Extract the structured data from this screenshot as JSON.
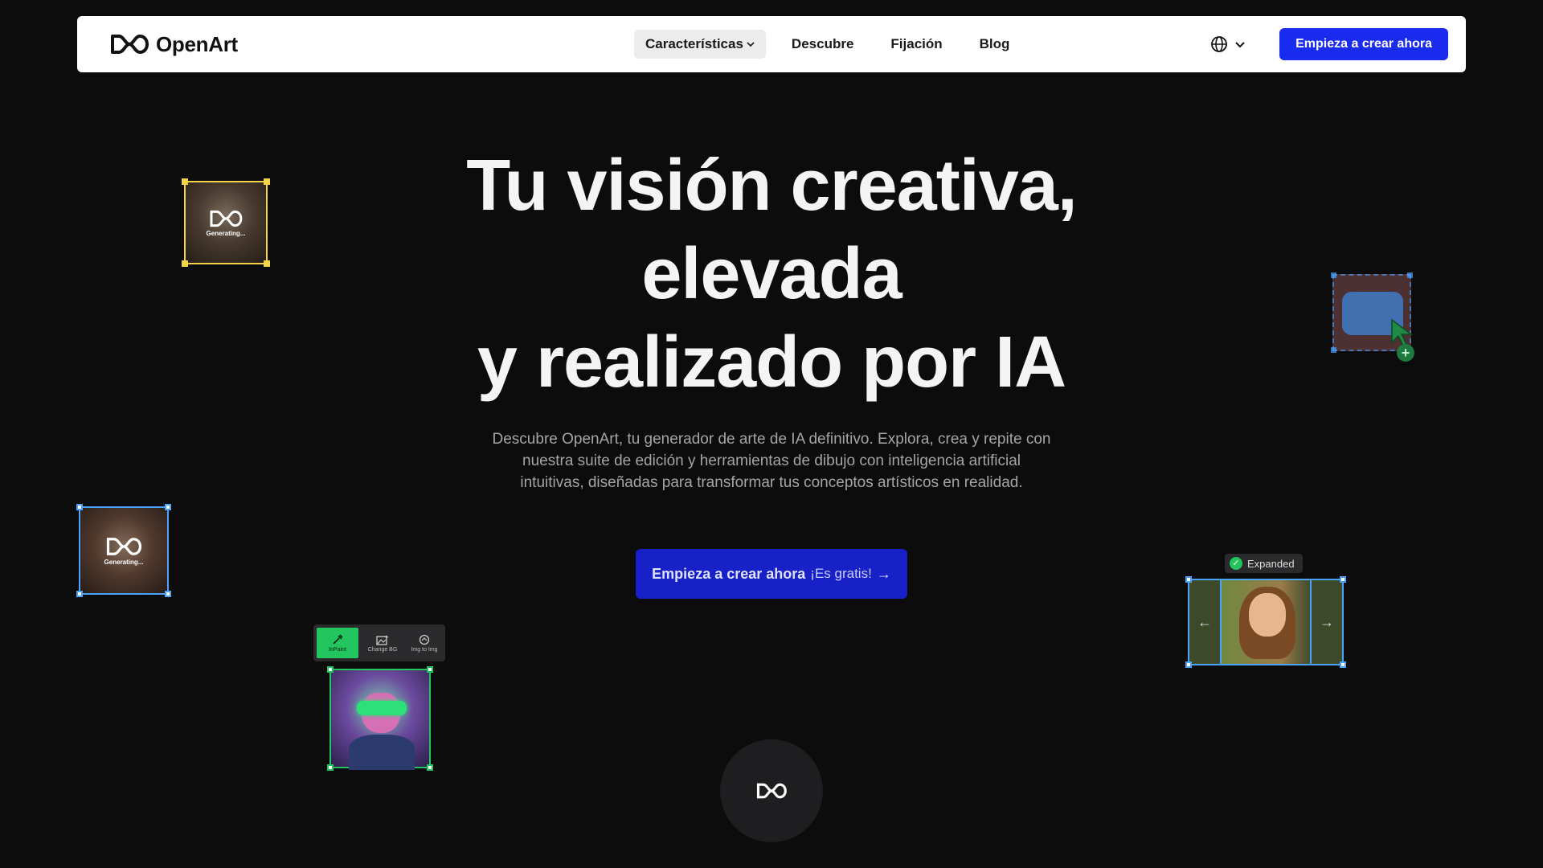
{
  "header": {
    "logo_text": "OpenArt",
    "menu": [
      {
        "label": "Características",
        "has_dropdown": true,
        "active": true
      },
      {
        "label": "Descubre"
      },
      {
        "label": "Fijación"
      },
      {
        "label": "Blog"
      }
    ],
    "language_icon": "globe-icon",
    "cta_label": "Empieza a crear ahora"
  },
  "hero": {
    "title_lines": [
      "Tu visión creativa,",
      "elevada",
      "y realizado por IA"
    ],
    "subtitle": "Descubre OpenArt, tu generador de arte de IA definitivo. Explora, crea y repite con nuestra suite de edición y herramientas de dibujo con inteligencia artificial intuitivas, diseñadas para transformar tus conceptos artísticos en realidad.",
    "cta_bold": "Empieza a crear ahora",
    "cta_normal": "¡Es gratis!",
    "cta_arrow": "→"
  },
  "cards": {
    "generating_label": "Generating...",
    "toolbar": [
      {
        "label": "InPaint",
        "icon": "inpaint-icon",
        "active": true
      },
      {
        "label": "Change BG",
        "icon": "change-bg-icon"
      },
      {
        "label": "Img to Img",
        "icon": "img-to-img-icon"
      }
    ],
    "expanded_label": "Expanded",
    "arrow_left": "←",
    "arrow_right": "→",
    "plus": "+"
  },
  "colors": {
    "accent": "#1a2bf0",
    "cta_main": "#1820c8",
    "success": "#22c55e",
    "selection_blue": "#4aa3ff",
    "selection_yellow": "#f2d44a"
  }
}
